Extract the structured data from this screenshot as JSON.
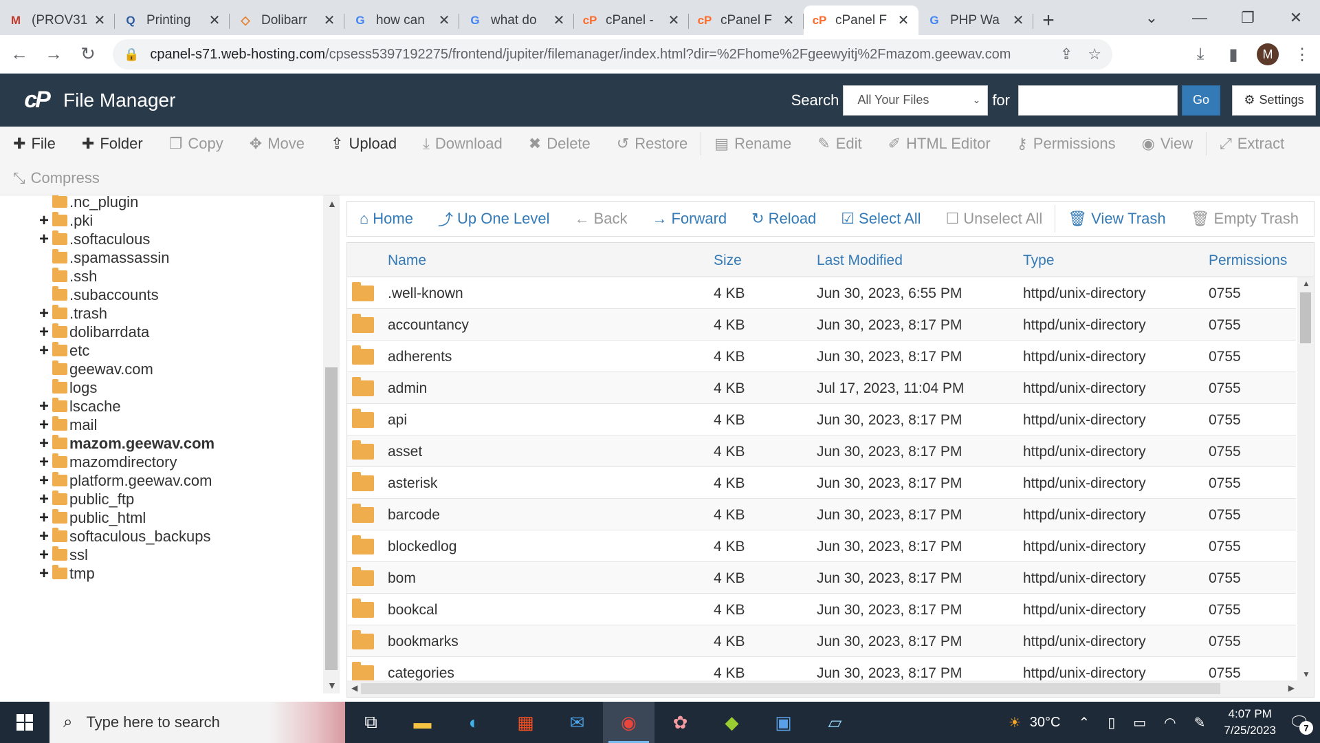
{
  "browser": {
    "tabs": [
      {
        "title": "(PROV31",
        "favicon": "M",
        "favicon_color": "#c0392b",
        "active": false
      },
      {
        "title": "Printing",
        "favicon": "Q",
        "favicon_color": "#2c5aa0",
        "active": false
      },
      {
        "title": "Dolibarr",
        "favicon": "◇",
        "favicon_color": "#e67e22",
        "active": false
      },
      {
        "title": "how can",
        "favicon": "G",
        "favicon_color": "#4285f4",
        "active": false
      },
      {
        "title": "what do",
        "favicon": "G",
        "favicon_color": "#4285f4",
        "active": false
      },
      {
        "title": "cPanel -",
        "favicon": "cP",
        "favicon_color": "#ff6c2c",
        "active": false
      },
      {
        "title": "cPanel F",
        "favicon": "cP",
        "favicon_color": "#ff6c2c",
        "active": false
      },
      {
        "title": "cPanel F",
        "favicon": "cP",
        "favicon_color": "#ff6c2c",
        "active": true
      },
      {
        "title": "PHP Wa",
        "favicon": "G",
        "favicon_color": "#4285f4",
        "active": false
      }
    ],
    "url_host": "cpanel-s71.web-hosting.com",
    "url_path": "/cpsess5397192275/frontend/jupiter/filemanager/index.html?dir=%2Fhome%2Fgeewyitj%2Fmazom.geewav.com",
    "profile_initial": "M"
  },
  "header": {
    "title": "File Manager",
    "search_label": "Search",
    "search_scope": "All Your Files",
    "for_label": "for",
    "search_value": "",
    "go_label": "Go",
    "settings_label": "Settings"
  },
  "toolbar": {
    "file": "File",
    "folder": "Folder",
    "copy": "Copy",
    "move": "Move",
    "upload": "Upload",
    "download": "Download",
    "delete": "Delete",
    "restore": "Restore",
    "rename": "Rename",
    "edit": "Edit",
    "html_editor": "HTML Editor",
    "permissions": "Permissions",
    "view": "View",
    "extract": "Extract",
    "compress": "Compress"
  },
  "tree": [
    {
      "label": ".nc_plugin",
      "plus": false,
      "bold": false
    },
    {
      "label": ".pki",
      "plus": true,
      "bold": false
    },
    {
      "label": ".softaculous",
      "plus": true,
      "bold": false
    },
    {
      "label": ".spamassassin",
      "plus": false,
      "bold": false
    },
    {
      "label": ".ssh",
      "plus": false,
      "bold": false
    },
    {
      "label": ".subaccounts",
      "plus": false,
      "bold": false
    },
    {
      "label": ".trash",
      "plus": true,
      "bold": false
    },
    {
      "label": "dolibarrdata",
      "plus": true,
      "bold": false
    },
    {
      "label": "etc",
      "plus": true,
      "bold": false
    },
    {
      "label": "geewav.com",
      "plus": false,
      "bold": false
    },
    {
      "label": "logs",
      "plus": false,
      "bold": false
    },
    {
      "label": "lscache",
      "plus": true,
      "bold": false
    },
    {
      "label": "mail",
      "plus": true,
      "bold": false
    },
    {
      "label": "mazom.geewav.com",
      "plus": true,
      "bold": true
    },
    {
      "label": "mazomdirectory",
      "plus": true,
      "bold": false
    },
    {
      "label": "platform.geewav.com",
      "plus": true,
      "bold": false
    },
    {
      "label": "public_ftp",
      "plus": true,
      "bold": false
    },
    {
      "label": "public_html",
      "plus": true,
      "bold": false
    },
    {
      "label": "softaculous_backups",
      "plus": true,
      "bold": false
    },
    {
      "label": "ssl",
      "plus": true,
      "bold": false
    },
    {
      "label": "tmp",
      "plus": true,
      "bold": false
    }
  ],
  "main_nav": {
    "home": "Home",
    "up_one_level": "Up One Level",
    "back": "Back",
    "forward": "Forward",
    "reload": "Reload",
    "select_all": "Select All",
    "unselect_all": "Unselect All",
    "view_trash": "View Trash",
    "empty_trash": "Empty Trash"
  },
  "table": {
    "columns": {
      "name": "Name",
      "size": "Size",
      "modified": "Last Modified",
      "type": "Type",
      "perms": "Permissions"
    },
    "rows": [
      {
        "name": ".well-known",
        "size": "4 KB",
        "modified": "Jun 30, 2023, 6:55 PM",
        "type": "httpd/unix-directory",
        "perms": "0755"
      },
      {
        "name": "accountancy",
        "size": "4 KB",
        "modified": "Jun 30, 2023, 8:17 PM",
        "type": "httpd/unix-directory",
        "perms": "0755"
      },
      {
        "name": "adherents",
        "size": "4 KB",
        "modified": "Jun 30, 2023, 8:17 PM",
        "type": "httpd/unix-directory",
        "perms": "0755"
      },
      {
        "name": "admin",
        "size": "4 KB",
        "modified": "Jul 17, 2023, 11:04 PM",
        "type": "httpd/unix-directory",
        "perms": "0755"
      },
      {
        "name": "api",
        "size": "4 KB",
        "modified": "Jun 30, 2023, 8:17 PM",
        "type": "httpd/unix-directory",
        "perms": "0755"
      },
      {
        "name": "asset",
        "size": "4 KB",
        "modified": "Jun 30, 2023, 8:17 PM",
        "type": "httpd/unix-directory",
        "perms": "0755"
      },
      {
        "name": "asterisk",
        "size": "4 KB",
        "modified": "Jun 30, 2023, 8:17 PM",
        "type": "httpd/unix-directory",
        "perms": "0755"
      },
      {
        "name": "barcode",
        "size": "4 KB",
        "modified": "Jun 30, 2023, 8:17 PM",
        "type": "httpd/unix-directory",
        "perms": "0755"
      },
      {
        "name": "blockedlog",
        "size": "4 KB",
        "modified": "Jun 30, 2023, 8:17 PM",
        "type": "httpd/unix-directory",
        "perms": "0755"
      },
      {
        "name": "bom",
        "size": "4 KB",
        "modified": "Jun 30, 2023, 8:17 PM",
        "type": "httpd/unix-directory",
        "perms": "0755"
      },
      {
        "name": "bookcal",
        "size": "4 KB",
        "modified": "Jun 30, 2023, 8:17 PM",
        "type": "httpd/unix-directory",
        "perms": "0755"
      },
      {
        "name": "bookmarks",
        "size": "4 KB",
        "modified": "Jun 30, 2023, 8:17 PM",
        "type": "httpd/unix-directory",
        "perms": "0755"
      },
      {
        "name": "categories",
        "size": "4 KB",
        "modified": "Jun 30, 2023, 8:17 PM",
        "type": "httpd/unix-directory",
        "perms": "0755"
      }
    ]
  },
  "taskbar": {
    "search_placeholder": "Type here to search",
    "weather": "30°C",
    "time": "4:07 PM",
    "date": "7/25/2023",
    "notifications": "7"
  }
}
